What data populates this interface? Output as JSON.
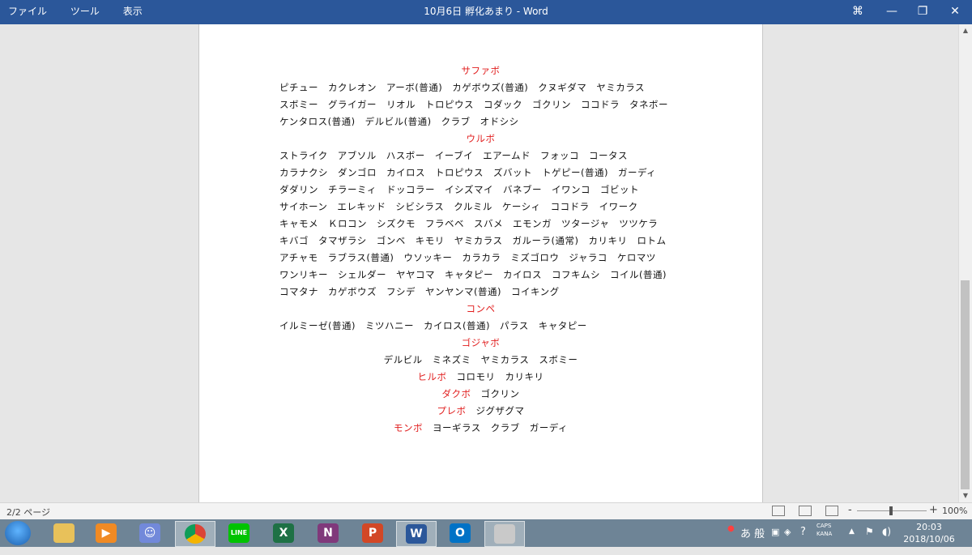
{
  "window": {
    "title": "10月6日 孵化あまり  -  Word",
    "menu": [
      "ファイル",
      "ツール",
      "表示"
    ],
    "buttons": {
      "focus": "⌘",
      "minimize": "—",
      "restore": "❐",
      "close": "✕"
    }
  },
  "document": {
    "headings": {
      "safari": "サファボ",
      "ultra": "ウルボ",
      "compe": "コンペ",
      "gorgeous": "ゴジャボ",
      "heal": "ヒルボ",
      "dusk": "ダクボ",
      "premier": "プレボ",
      "moon": "モンボ"
    },
    "safari_lines": [
      "ピチュー　カクレオン　アーボ(普通)　カゲボウズ(普通)　クヌギダマ　ヤミカラス",
      "スボミー　グライガー　リオル　トロピウス　コダック　ゴクリン　ココドラ　タネボー",
      "ケンタロス(普通)　デルビル(普通)　クラブ　オドシシ"
    ],
    "ultra_lines": [
      "ストライク　アブソル　ハスボー　イーブイ　エアームド　フォッコ　コータス",
      "カラナクシ　ダンゴロ　カイロス　トロピウス　ズバット　トゲピー(普通)　ガーディ",
      "ダダリン　チラーミィ　ドッコラー　イシズマイ　バネブー　イワンコ　ゴビット",
      "サイホーン　エレキッド　シビシラス　クルミル　ケーシィ　ココドラ　イワーク",
      "キャモメ　Ｋロコン　シズクモ　フラベベ　スバメ　エモンガ　ツタージャ　ツツケラ",
      "キバゴ　タマザラシ　ゴンベ　キモリ　ヤミカラス　ガルーラ(通常)　カリキリ　ロトム",
      "アチャモ　ラブラス(普通)　ウソッキー　カラカラ　ミズゴロウ　ジャラコ　ケロマツ",
      "ワンリキー　シェルダー　ヤヤコマ　キャタピー　カイロス　コフキムシ　コイル(普通)",
      "コマタナ　カゲボウズ　フシデ　ヤンヤンマ(普通)　コイキング"
    ],
    "compe_line": "イルミーゼ(普通)　ミツハニー　カイロス(普通)　パラス　キャタピー",
    "gorgeous_line": "デルビル　ミネズミ　ヤミカラス　スボミー",
    "heal_line": "　コロモリ　カリキリ",
    "dusk_line": "　ゴクリン",
    "premier_line": "　ジグザグマ",
    "moon_line": "　ヨーギラス　クラブ　ガーディ"
  },
  "statusbar": {
    "page": "2/2 ページ",
    "zoom": "100%",
    "minus": "-",
    "plus": "+"
  },
  "taskbar": {
    "apps": [
      "start",
      "explorer",
      "media-player",
      "discord",
      "chrome",
      "line",
      "excel",
      "onenote",
      "powerpoint",
      "word",
      "outlook",
      "paint"
    ],
    "labels": {
      "line": "LINE",
      "excel": "X",
      "onenote": "N",
      "powerpoint": "P",
      "word": "W",
      "outlook": "O"
    },
    "ime": "あ 般",
    "caps": "CAPS",
    "kana": "KANA",
    "time": "20:03",
    "date": "2018/10/06"
  },
  "colors": {
    "titlebar": "#2b579a",
    "heading_red": "#e11d1d"
  }
}
